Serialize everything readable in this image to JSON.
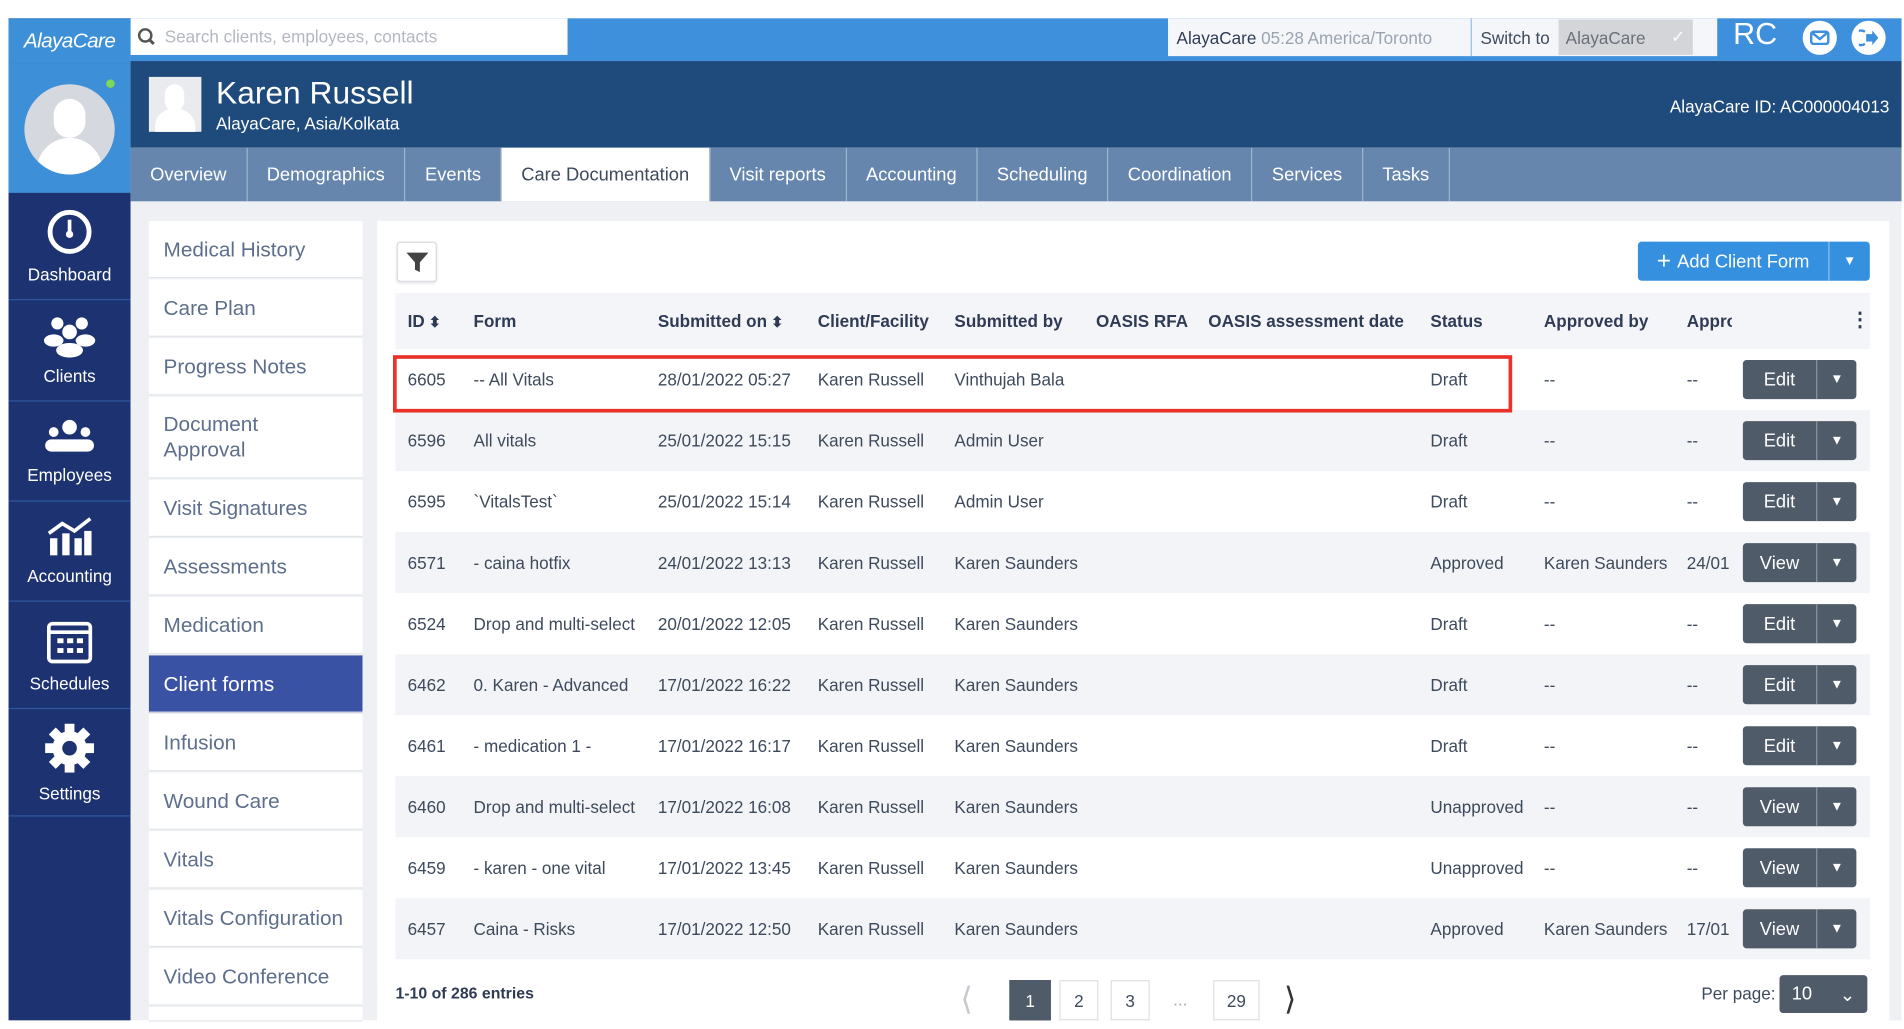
{
  "app": {
    "logo": "AlayaCare",
    "search_placeholder": "Search clients, employees, contacts",
    "agency": "AlayaCare",
    "time": "05:28 America/Toronto",
    "switch_label": "Switch to",
    "switch_value": "AlayaCare",
    "user_initials": "RC"
  },
  "nav": [
    {
      "label": "Dashboard",
      "icon": "dashboard-icon"
    },
    {
      "label": "Clients",
      "icon": "clients-icon"
    },
    {
      "label": "Employees",
      "icon": "employees-icon"
    },
    {
      "label": "Accounting",
      "icon": "accounting-icon"
    },
    {
      "label": "Schedules",
      "icon": "calendar-icon"
    },
    {
      "label": "Settings",
      "icon": "gear-icon"
    }
  ],
  "client": {
    "name": "Karen Russell",
    "subtitle": "AlayaCare, Asia/Kolkata",
    "id_label": "AlayaCare ID: AC000004013"
  },
  "tabs": [
    "Overview",
    "Demographics",
    "Events",
    "Care Documentation",
    "Visit reports",
    "Accounting",
    "Scheduling",
    "Coordination",
    "Services",
    "Tasks"
  ],
  "active_tab": "Care Documentation",
  "subnav": [
    "Medical History",
    "Care Plan",
    "Progress Notes",
    "Document Approval",
    "Visit Signatures",
    "Assessments",
    "Medication",
    "Client forms",
    "Infusion",
    "Wound Care",
    "Vitals",
    "Vitals Configuration",
    "Video Conference"
  ],
  "active_subnav": "Client forms",
  "add_button": "Add Client Form",
  "table": {
    "headers": [
      "ID",
      "Form",
      "Submitted on",
      "Client/Facility",
      "Submitted by",
      "OASIS RFA",
      "OASIS assessment date",
      "Status",
      "Approved by",
      "Appro"
    ],
    "rows": [
      [
        "6605",
        "-- All Vitals",
        "28/01/2022 05:27",
        "Karen Russell",
        "Vinthujah Bala",
        "",
        "",
        "Draft",
        "--",
        "--",
        "Edit"
      ],
      [
        "6596",
        "All vitals",
        "25/01/2022 15:15",
        "Karen Russell",
        "Admin User",
        "",
        "",
        "Draft",
        "--",
        "--",
        "Edit"
      ],
      [
        "6595",
        "`VitalsTest`",
        "25/01/2022 15:14",
        "Karen Russell",
        "Admin User",
        "",
        "",
        "Draft",
        "--",
        "--",
        "Edit"
      ],
      [
        "6571",
        "- caina hotfix",
        "24/01/2022 13:13",
        "Karen Russell",
        "Karen Saunders",
        "",
        "",
        "Approved",
        "Karen Saunders",
        "24/01",
        "View"
      ],
      [
        "6524",
        "Drop and multi-select",
        "20/01/2022 12:05",
        "Karen Russell",
        "Karen Saunders",
        "",
        "",
        "Draft",
        "--",
        "--",
        "Edit"
      ],
      [
        "6462",
        "0. Karen - Advanced",
        "17/01/2022 16:22",
        "Karen Russell",
        "Karen Saunders",
        "",
        "",
        "Draft",
        "--",
        "--",
        "Edit"
      ],
      [
        "6461",
        "- medication 1 -",
        "17/01/2022 16:17",
        "Karen Russell",
        "Karen Saunders",
        "",
        "",
        "Draft",
        "--",
        "--",
        "Edit"
      ],
      [
        "6460",
        "Drop and multi-select",
        "17/01/2022 16:08",
        "Karen Russell",
        "Karen Saunders",
        "",
        "",
        "Unapproved",
        "--",
        "--",
        "View"
      ],
      [
        "6459",
        "- karen - one vital",
        "17/01/2022 13:45",
        "Karen Russell",
        "Karen Saunders",
        "",
        "",
        "Unapproved",
        "--",
        "--",
        "View"
      ],
      [
        "6457",
        "Caina - Risks",
        "17/01/2022 12:50",
        "Karen Russell",
        "Karen Saunders",
        "",
        "",
        "Approved",
        "Karen Saunders",
        "17/01",
        "View"
      ]
    ]
  },
  "footer": {
    "entries": "1-10 of 286 entries",
    "pages": [
      "1",
      "2",
      "3",
      "...",
      "29"
    ],
    "current_page": "1",
    "per_page_label": "Per page:",
    "per_page": "10"
  },
  "colors": {
    "nav": "#1d3270",
    "topbar": "#3e8fdc",
    "header": "#1e4a7c",
    "tabs": "#6686ad",
    "active_subnav": "#3a52a3",
    "action_button": "#4f5b69",
    "highlight": "#e8322a"
  }
}
